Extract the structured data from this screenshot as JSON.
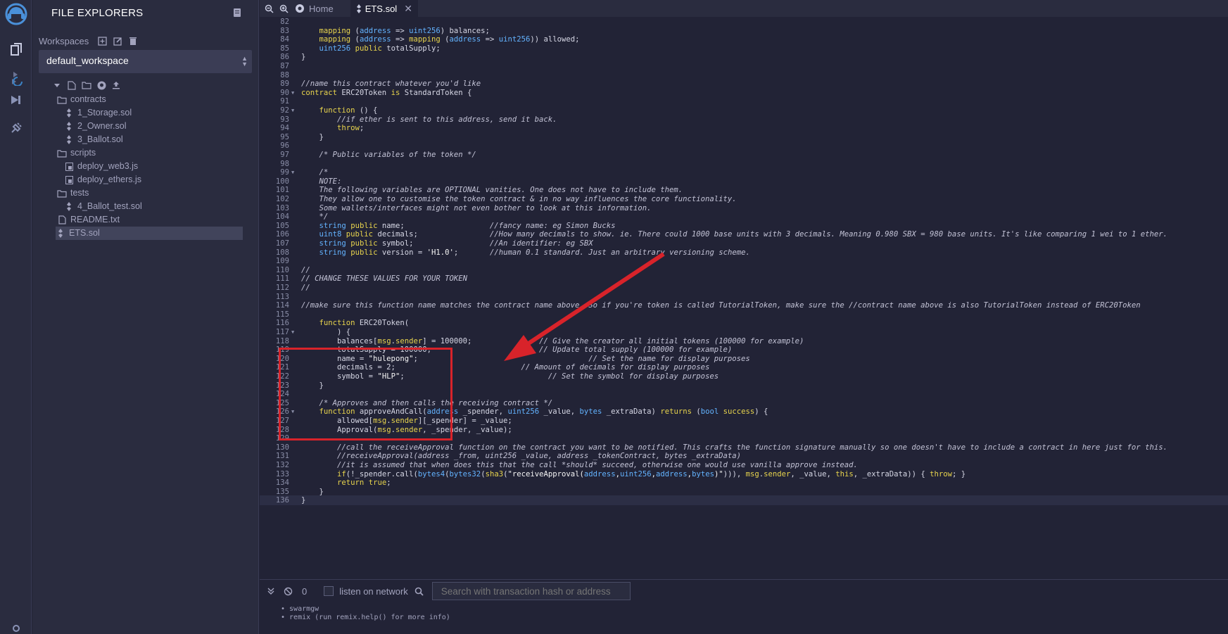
{
  "sidebar": {
    "title": "FILE EXPLORERS",
    "workspaces_label": "Workspaces",
    "workspace_selected": "default_workspace",
    "tree": [
      {
        "label": "contracts",
        "kind": "folder",
        "depth": 0
      },
      {
        "label": "1_Storage.sol",
        "kind": "sol",
        "depth": 1
      },
      {
        "label": "2_Owner.sol",
        "kind": "sol",
        "depth": 1
      },
      {
        "label": "3_Ballot.sol",
        "kind": "sol",
        "depth": 1
      },
      {
        "label": "scripts",
        "kind": "folder",
        "depth": 0
      },
      {
        "label": "deploy_web3.js",
        "kind": "js",
        "depth": 1
      },
      {
        "label": "deploy_ethers.js",
        "kind": "js",
        "depth": 1
      },
      {
        "label": "tests",
        "kind": "folder",
        "depth": 0
      },
      {
        "label": "4_Ballot_test.sol",
        "kind": "sol",
        "depth": 1
      },
      {
        "label": "README.txt",
        "kind": "file",
        "depth": 0
      },
      {
        "label": "ETS.sol",
        "kind": "sol",
        "depth": 0,
        "selected": true
      }
    ]
  },
  "tabs": [
    {
      "label": "Home",
      "active": false
    },
    {
      "label": "ETS.sol",
      "active": true
    }
  ],
  "code_lines": [
    {
      "n": "82",
      "t": ""
    },
    {
      "n": "83",
      "t": "    mapping (address => uint256) balances;"
    },
    {
      "n": "84",
      "t": "    mapping (address => mapping (address => uint256)) allowed;"
    },
    {
      "n": "85",
      "t": "    uint256 public totalSupply;"
    },
    {
      "n": "86",
      "t": "}"
    },
    {
      "n": "87",
      "t": ""
    },
    {
      "n": "88",
      "t": ""
    },
    {
      "n": "89",
      "t": "//name this contract whatever you'd like"
    },
    {
      "n": "90",
      "t": "contract ERC20Token is StandardToken {",
      "fold": true
    },
    {
      "n": "91",
      "t": ""
    },
    {
      "n": "92",
      "t": "    function () {",
      "fold": true
    },
    {
      "n": "93",
      "t": "        //if ether is sent to this address, send it back."
    },
    {
      "n": "94",
      "t": "        throw;"
    },
    {
      "n": "95",
      "t": "    }"
    },
    {
      "n": "96",
      "t": ""
    },
    {
      "n": "97",
      "t": "    /* Public variables of the token */"
    },
    {
      "n": "98",
      "t": ""
    },
    {
      "n": "99",
      "t": "    /*",
      "fold": true
    },
    {
      "n": "100",
      "t": "    NOTE:"
    },
    {
      "n": "101",
      "t": "    The following variables are OPTIONAL vanities. One does not have to include them."
    },
    {
      "n": "102",
      "t": "    They allow one to customise the token contract & in no way influences the core functionality."
    },
    {
      "n": "103",
      "t": "    Some wallets/interfaces might not even bother to look at this information."
    },
    {
      "n": "104",
      "t": "    */"
    },
    {
      "n": "105",
      "t": "    string public name;                   //fancy name: eg Simon Bucks"
    },
    {
      "n": "106",
      "t": "    uint8 public decimals;                //How many decimals to show. ie. There could 1000 base units with 3 decimals. Meaning 0.980 SBX = 980 base units. It's like comparing 1 wei to 1 ether."
    },
    {
      "n": "107",
      "t": "    string public symbol;                 //An identifier: eg SBX"
    },
    {
      "n": "108",
      "t": "    string public version = 'H1.0';       //human 0.1 standard. Just an arbitrary versioning scheme."
    },
    {
      "n": "109",
      "t": ""
    },
    {
      "n": "110",
      "t": "//"
    },
    {
      "n": "111",
      "t": "// CHANGE THESE VALUES FOR YOUR TOKEN"
    },
    {
      "n": "112",
      "t": "//"
    },
    {
      "n": "113",
      "t": ""
    },
    {
      "n": "114",
      "t": "//make sure this function name matches the contract name above. So if you're token is called TutorialToken, make sure the //contract name above is also TutorialToken instead of ERC20Token"
    },
    {
      "n": "115",
      "t": ""
    },
    {
      "n": "116",
      "t": "    function ERC20Token("
    },
    {
      "n": "117",
      "t": "        ) {",
      "fold": true
    },
    {
      "n": "118",
      "t": "        balances[msg.sender] = 100000;               // Give the creator all initial tokens (100000 for example)"
    },
    {
      "n": "119",
      "t": "        totalSupply = 100000;                        // Update total supply (100000 for example)"
    },
    {
      "n": "120",
      "t": "        name = \"hulepong\";                                      // Set the name for display purposes"
    },
    {
      "n": "121",
      "t": "        decimals = 2;                            // Amount of decimals for display purposes"
    },
    {
      "n": "122",
      "t": "        symbol = \"HLP\";                                // Set the symbol for display purposes"
    },
    {
      "n": "123",
      "t": "    }"
    },
    {
      "n": "124",
      "t": ""
    },
    {
      "n": "125",
      "t": "    /* Approves and then calls the receiving contract */"
    },
    {
      "n": "126",
      "t": "    function approveAndCall(address _spender, uint256 _value, bytes _extraData) returns (bool success) {",
      "fold": true
    },
    {
      "n": "127",
      "t": "        allowed[msg.sender][_spender] = _value;"
    },
    {
      "n": "128",
      "t": "        Approval(msg.sender, _spender, _value);"
    },
    {
      "n": "129",
      "t": ""
    },
    {
      "n": "130",
      "t": "        //call the receiveApproval function on the contract you want to be notified. This crafts the function signature manually so one doesn't have to include a contract in here just for this."
    },
    {
      "n": "131",
      "t": "        //receiveApproval(address _from, uint256 _value, address _tokenContract, bytes _extraData)"
    },
    {
      "n": "132",
      "t": "        //it is assumed that when does this that the call *should* succeed, otherwise one would use vanilla approve instead."
    },
    {
      "n": "133",
      "t": "        if(!_spender.call(bytes4(bytes32(sha3(\"receiveApproval(address,uint256,address,bytes)\"))), msg.sender, _value, this, _extraData)) { throw; }"
    },
    {
      "n": "134",
      "t": "        return true;"
    },
    {
      "n": "135",
      "t": "    }"
    },
    {
      "n": "136",
      "t": "}"
    }
  ],
  "terminal": {
    "count": "0",
    "listen_label": "listen on network",
    "search_placeholder": "Search with transaction hash or address",
    "output": [
      "• swarmgw",
      "• remix (run remix.help() for more info)"
    ]
  },
  "colors": {
    "background": "#222336",
    "sidebar": "#2a2c3f",
    "highlight_box": "#d8232a",
    "keyword": "#e8d44d",
    "type": "#63b3ff"
  }
}
